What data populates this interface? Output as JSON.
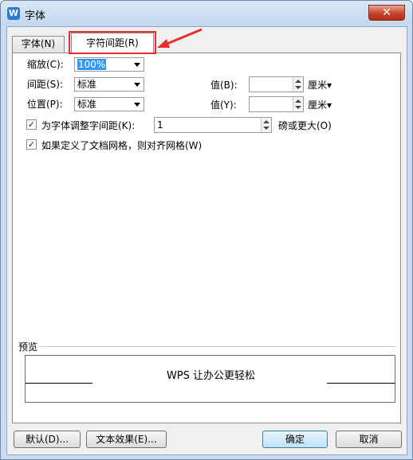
{
  "window": {
    "title": "字体",
    "app_icon": "wps-writer-icon"
  },
  "tabs": [
    {
      "label": "字体(N)"
    },
    {
      "label": "字符间距(R)",
      "active": true
    }
  ],
  "form": {
    "scale_label": "缩放(C):",
    "scale_value": "100%",
    "spacing_label": "间距(S):",
    "spacing_value": "标准",
    "spacing_by_label": "值(B):",
    "spacing_by_value": "",
    "spacing_unit": "厘米",
    "position_label": "位置(P):",
    "position_value": "标准",
    "position_by_label": "值(Y):",
    "position_by_value": "",
    "position_unit": "厘米",
    "kerning_label": "为字体调整字间距(K):",
    "kerning_checked": true,
    "kerning_value": "1",
    "kerning_suffix": "磅或更大(O)",
    "grid_label": "如果定义了文档网格，则对齐网格(W)",
    "grid_checked": true
  },
  "preview": {
    "group_label": "预览",
    "text": "WPS 让办公更轻松"
  },
  "buttons": {
    "default": "默认(D)...",
    "text_effects": "文本效果(E)...",
    "ok": "确定",
    "cancel": "取消"
  },
  "annotation": {
    "highlight_color": "#e53030"
  }
}
